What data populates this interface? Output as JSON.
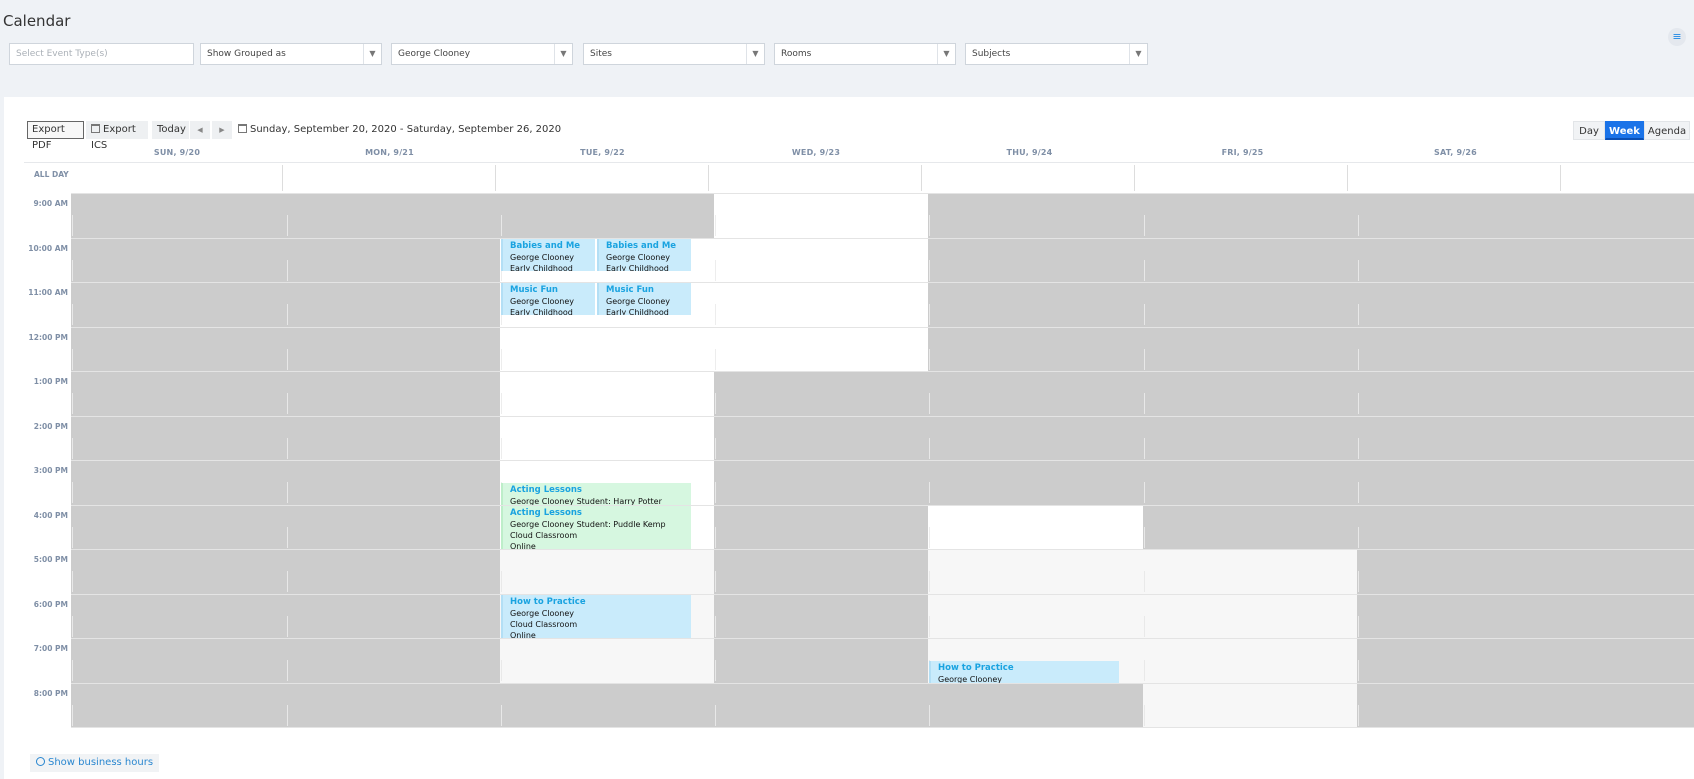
{
  "page": {
    "title": "Calendar"
  },
  "filters": [
    {
      "placeholder": "Select Event Type(s)",
      "value": "",
      "has_arrow": false
    },
    {
      "placeholder": "",
      "value": "Show Grouped as",
      "has_arrow": true
    },
    {
      "placeholder": "",
      "value": "George Clooney",
      "has_arrow": true
    },
    {
      "placeholder": "",
      "value": "Sites",
      "has_arrow": true
    },
    {
      "placeholder": "",
      "value": "Rooms",
      "has_arrow": true
    },
    {
      "placeholder": "",
      "value": "Subjects",
      "has_arrow": true
    }
  ],
  "toolbar": {
    "export_pdf": "Export PDF",
    "export_ics": "Export ICS",
    "today": "Today",
    "prev": "◀",
    "next": "▶",
    "range": "Sunday, September 20, 2020 - Saturday, September 26, 2020"
  },
  "views": [
    {
      "label": "Day",
      "active": false
    },
    {
      "label": "Week",
      "active": true
    },
    {
      "label": "Agenda",
      "active": false
    }
  ],
  "days": [
    "SUN, 9/20",
    "MON, 9/21",
    "TUE, 9/22",
    "WED, 9/23",
    "THU, 9/24",
    "FRI, 9/25",
    "SAT, 9/26"
  ],
  "all_day_label": "ALL DAY",
  "hours": [
    "9:00 AM",
    "10:00 AM",
    "11:00 AM",
    "12:00 PM",
    "1:00 PM",
    "2:00 PM",
    "3:00 PM",
    "4:00 PM",
    "5:00 PM",
    "6:00 PM",
    "7:00 PM",
    "8:00 PM"
  ],
  "cell_state": [
    [
      "n",
      "n",
      "n",
      "b",
      "n",
      "n",
      "n"
    ],
    [
      "n",
      "n",
      "b",
      "b",
      "n",
      "n",
      "n"
    ],
    [
      "n",
      "n",
      "b",
      "b",
      "n",
      "n",
      "n"
    ],
    [
      "n",
      "n",
      "b",
      "b",
      "n",
      "n",
      "n"
    ],
    [
      "n",
      "n",
      "b",
      "n",
      "n",
      "n",
      "n"
    ],
    [
      "n",
      "n",
      "b",
      "n",
      "n",
      "n",
      "n"
    ],
    [
      "n",
      "n",
      "b",
      "n",
      "n",
      "n",
      "n"
    ],
    [
      "n",
      "n",
      "b",
      "n",
      "b",
      "n",
      "n"
    ],
    [
      "n",
      "n",
      "o",
      "n",
      "o",
      "o",
      "n"
    ],
    [
      "n",
      "n",
      "o",
      "n",
      "o",
      "o",
      "n"
    ],
    [
      "n",
      "n",
      "o",
      "n",
      "o",
      "o",
      "n"
    ],
    [
      "n",
      "n",
      "n",
      "n",
      "n",
      "o",
      "n"
    ]
  ],
  "cell_colors": {
    "n": "#cccccc",
    "b": "#ffffff",
    "o": "#f7f7f7"
  },
  "events": [
    {
      "day": 2,
      "start": 1.0,
      "end": 1.75,
      "col": 0,
      "cols": 2,
      "color": "blue",
      "title": "Babies and Me",
      "lines": [
        "George Clooney",
        "Early Childhood"
      ]
    },
    {
      "day": 2,
      "start": 1.0,
      "end": 1.75,
      "col": 1,
      "cols": 2,
      "color": "blue",
      "title": "Babies and Me",
      "lines": [
        "George Clooney",
        "Early Childhood"
      ]
    },
    {
      "day": 2,
      "start": 2.0,
      "end": 2.75,
      "col": 0,
      "cols": 2,
      "color": "blue",
      "title": "Music Fun",
      "lines": [
        "George Clooney",
        "Early Childhood"
      ]
    },
    {
      "day": 2,
      "start": 2.0,
      "end": 2.75,
      "col": 1,
      "cols": 2,
      "color": "blue",
      "title": "Music Fun",
      "lines": [
        "George Clooney",
        "Early Childhood"
      ]
    },
    {
      "day": 2,
      "start": 6.5,
      "end": 7.0,
      "col": 0,
      "cols": 1,
      "color": "green",
      "title": "Acting Lessons",
      "lines": [
        "George Clooney Student: Harry Potter"
      ]
    },
    {
      "day": 2,
      "start": 7.0,
      "end": 8.0,
      "col": 0,
      "cols": 1,
      "color": "green",
      "title": "Acting Lessons",
      "lines": [
        "George Clooney Student: Puddle Kemp",
        "Cloud Classroom",
        "Online"
      ]
    },
    {
      "day": 2,
      "start": 9.0,
      "end": 10.0,
      "col": 0,
      "cols": 1,
      "color": "blue",
      "title": "How to Practice",
      "lines": [
        "George Clooney",
        "Cloud Classroom",
        "Online"
      ]
    },
    {
      "day": 4,
      "start": 10.5,
      "end": 11.0,
      "col": 0,
      "cols": 1,
      "color": "blue",
      "title": "How to Practice",
      "lines": [
        "George Clooney"
      ]
    }
  ],
  "business_hours": "Show business hours"
}
